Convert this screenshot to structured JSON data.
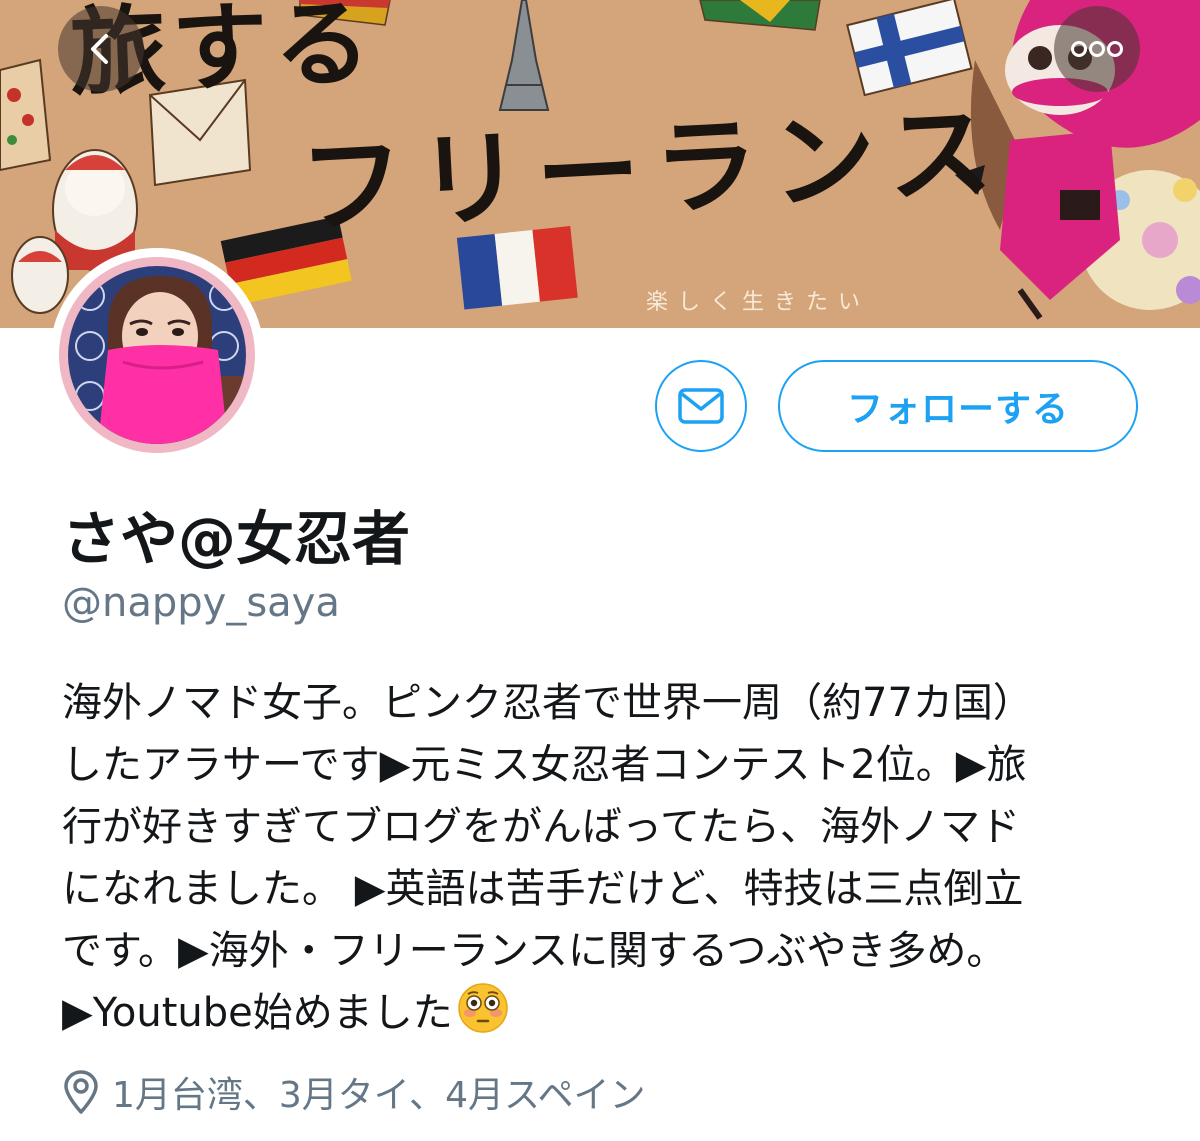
{
  "header": {
    "banner_title_line1": "旅する",
    "banner_title_line2": "フリーランス",
    "banner_tagline": "楽しく生きたい",
    "back_icon": "chevron-left-icon",
    "more_icon": "more-horizontal-icon"
  },
  "profile": {
    "display_name": "さや@女忍者",
    "handle": "@nappy_saya",
    "bio_lines": [
      "海外ノマド女子。ピンク忍者で世界一周（約77カ国）",
      "したアラサーです▶元ミス女忍者コンテスト2位。▶旅",
      "行が好きすぎてブログをがんばってたら、海外ノマド",
      "になれました。 ▶英語は苦手だけど、特技は三点倒立",
      "です。▶海外・フリーランスに関するつぶやき多め。",
      "▶Youtube始めました"
    ],
    "bio_emoji": "flushed-face-emoji",
    "location": "1月台湾、3月タイ、4月スペイン",
    "location_icon": "location-pin-icon"
  },
  "actions": {
    "message_icon": "envelope-icon",
    "follow_label": "フォローする"
  },
  "colors": {
    "accent": "#1da1f2",
    "secondary_text": "#657786",
    "primary_text": "#14171a",
    "avatar_ring": "#f0b8c5"
  }
}
